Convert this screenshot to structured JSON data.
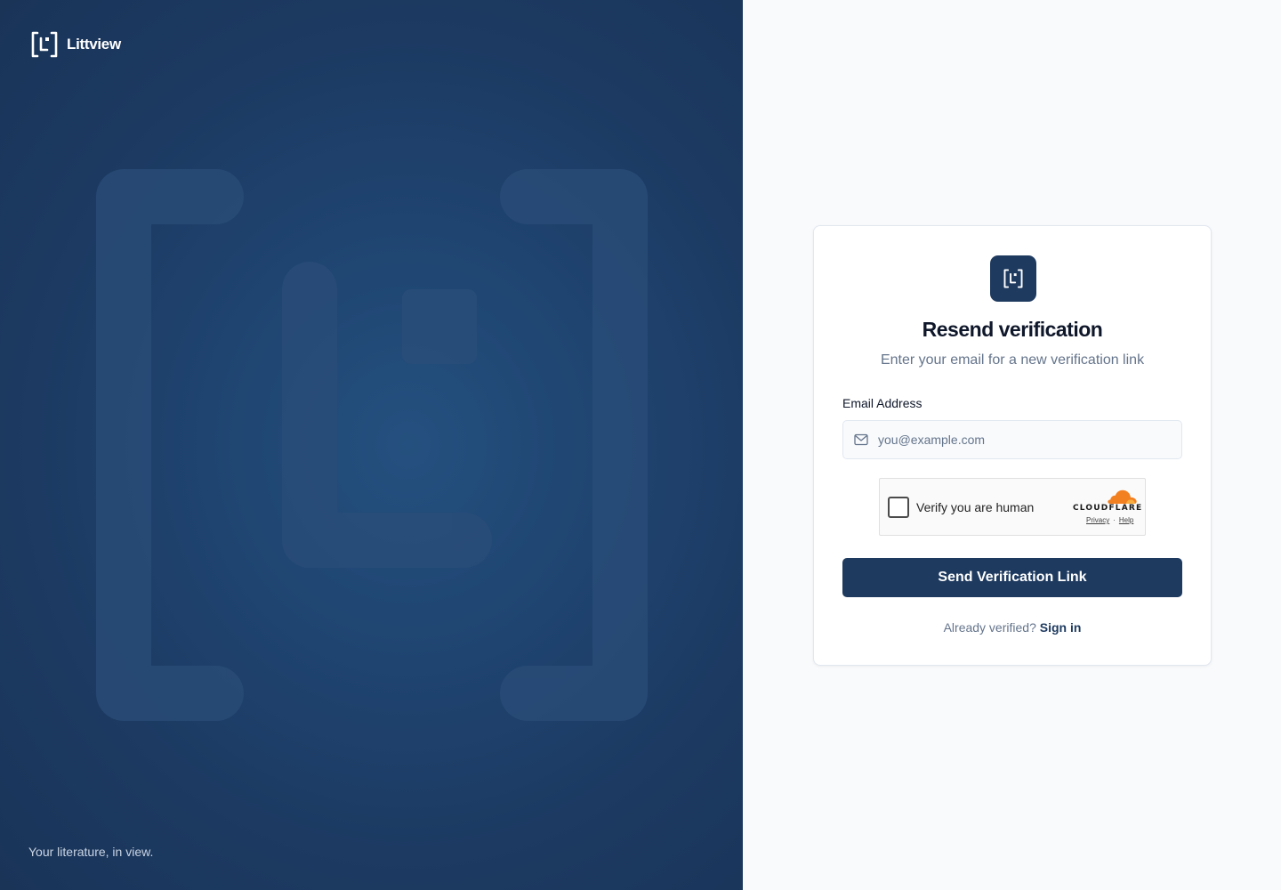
{
  "brand": {
    "name": "Littview",
    "tagline": "Your literature, in view."
  },
  "card": {
    "title": "Resend verification",
    "subtitle": "Enter your email for a new verification link",
    "email_label": "Email Address",
    "email_placeholder": "you@example.com",
    "email_value": "",
    "submit_label": "Send Verification Link",
    "footer_text": "Already verified?",
    "footer_link": "Sign in"
  },
  "captcha": {
    "label": "Verify you are human",
    "brand": "CLOUDFLARE",
    "privacy": "Privacy",
    "separator": "·",
    "help": "Help"
  },
  "colors": {
    "primary": "#1e3a5f",
    "left_panel_bg": "#1f4470",
    "page_bg": "#f8fafc",
    "muted_text": "#64748b",
    "cloudflare_orange": "#f38020"
  },
  "icons": {
    "brand": "littview-bracket-logo-icon",
    "email": "mail-icon",
    "captcha": "cloudflare-cloud-icon"
  }
}
